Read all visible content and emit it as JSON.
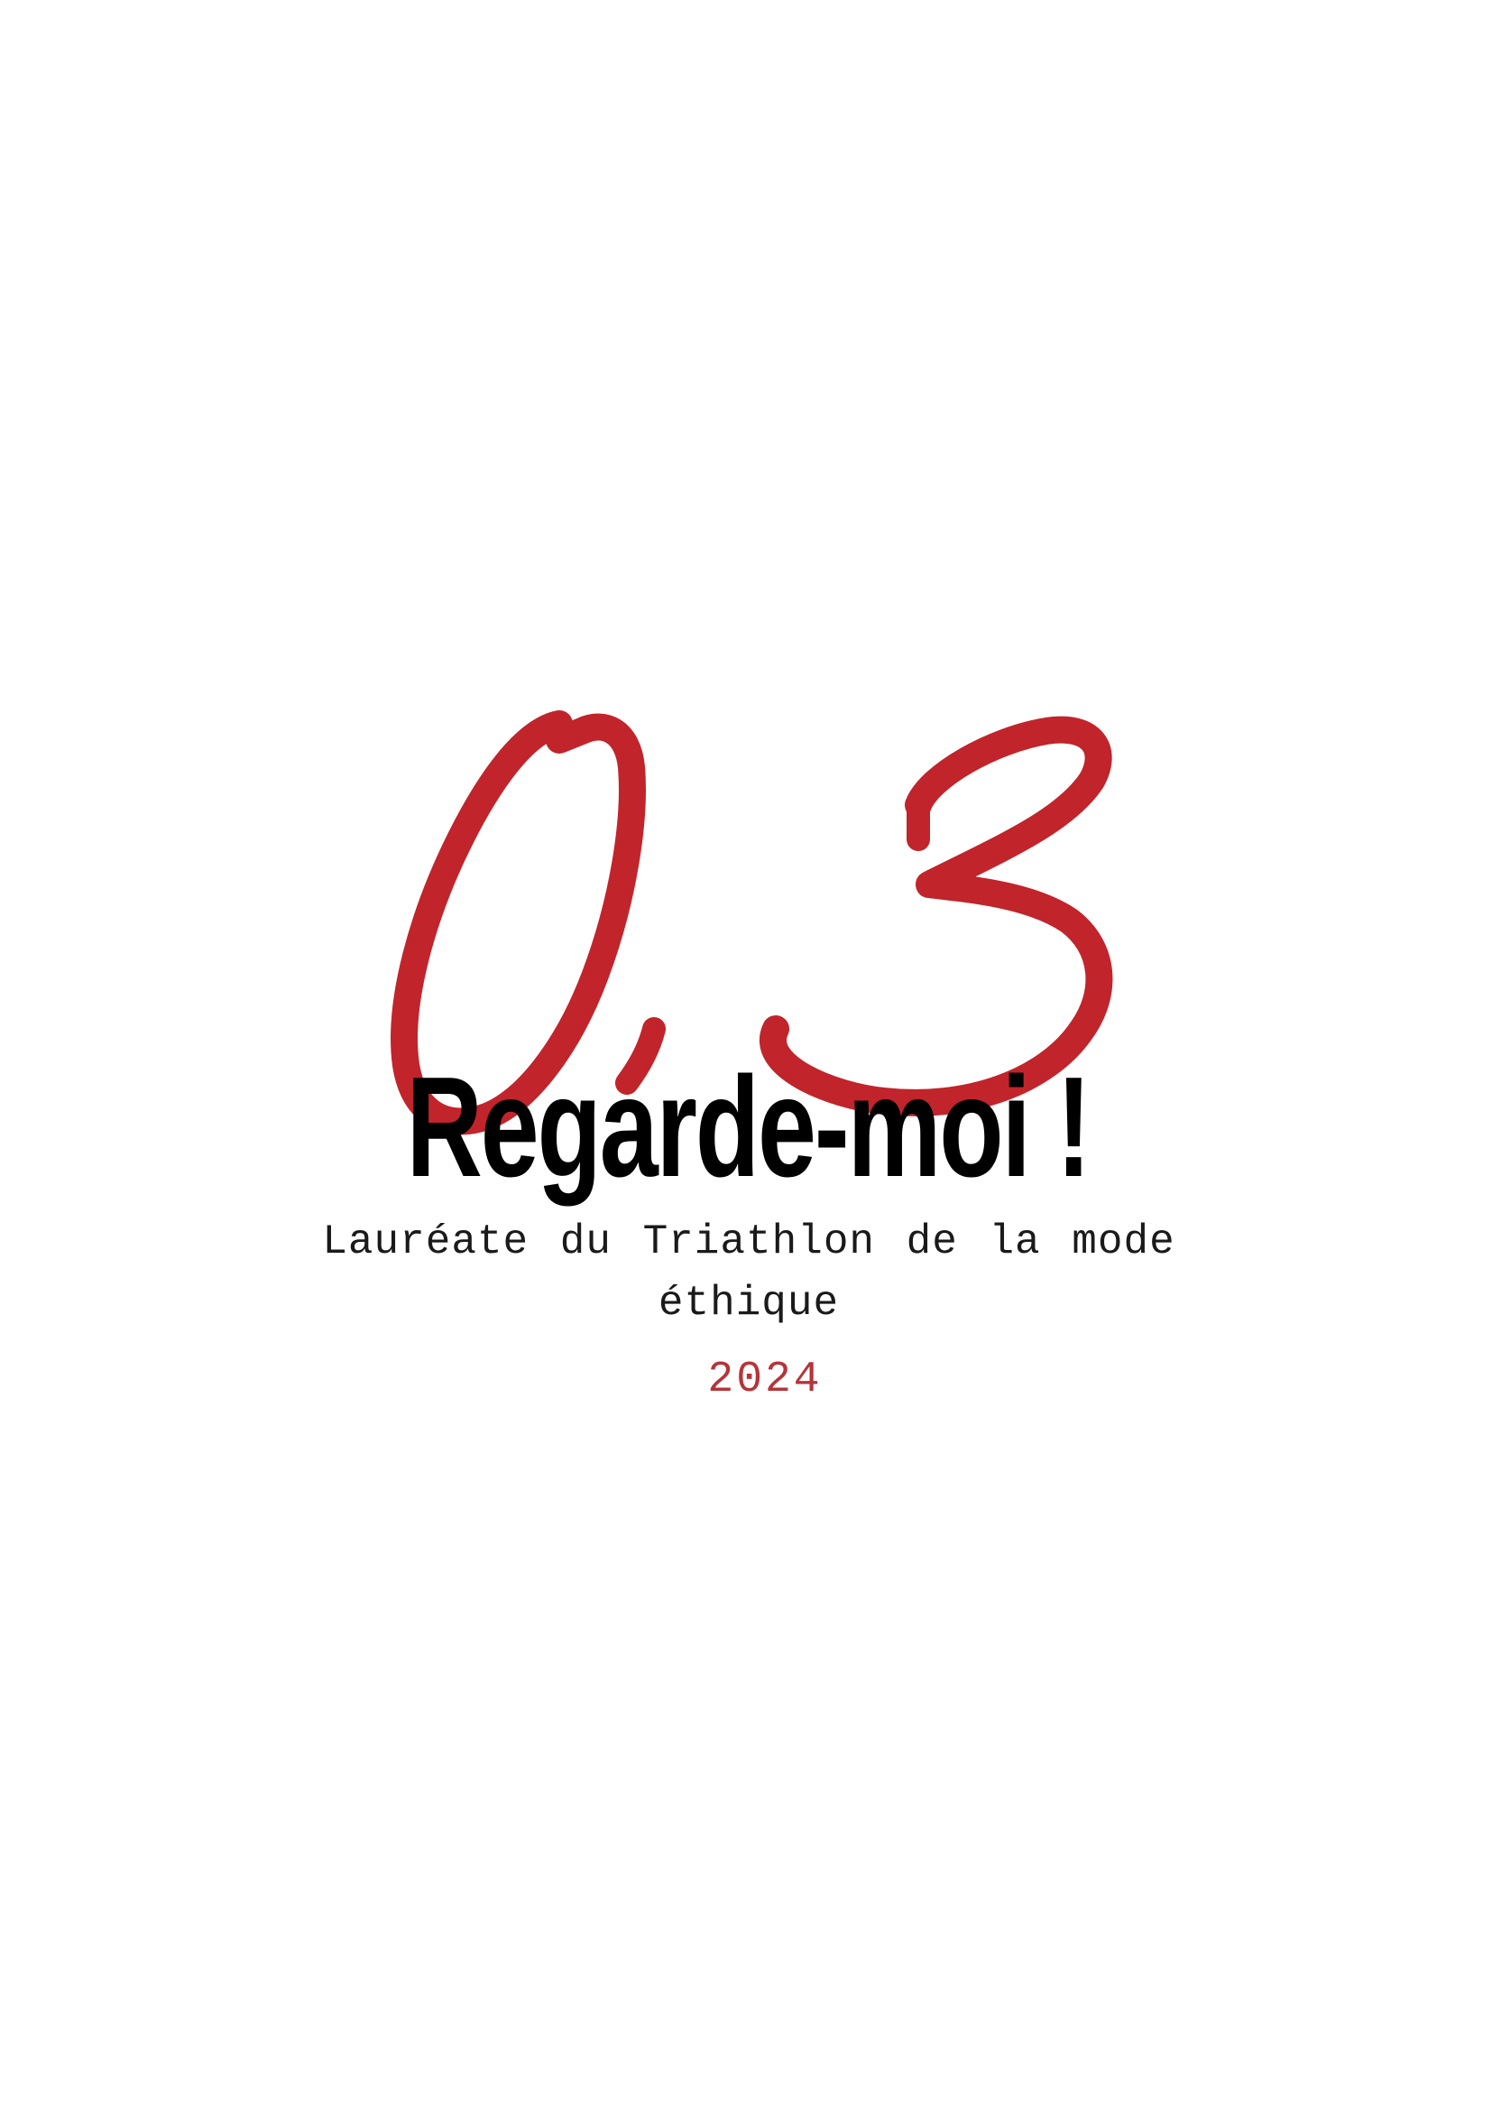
{
  "cover": {
    "logo_text": "0,3",
    "title": "Regarde-moi !",
    "subtitle": "Lauréate du Triathlon de la mode éthique",
    "year": "2024"
  },
  "colors": {
    "logo_red": "#c1242b",
    "title_black": "#000000",
    "year_red": "#b5343a",
    "background": "#ffffff"
  }
}
